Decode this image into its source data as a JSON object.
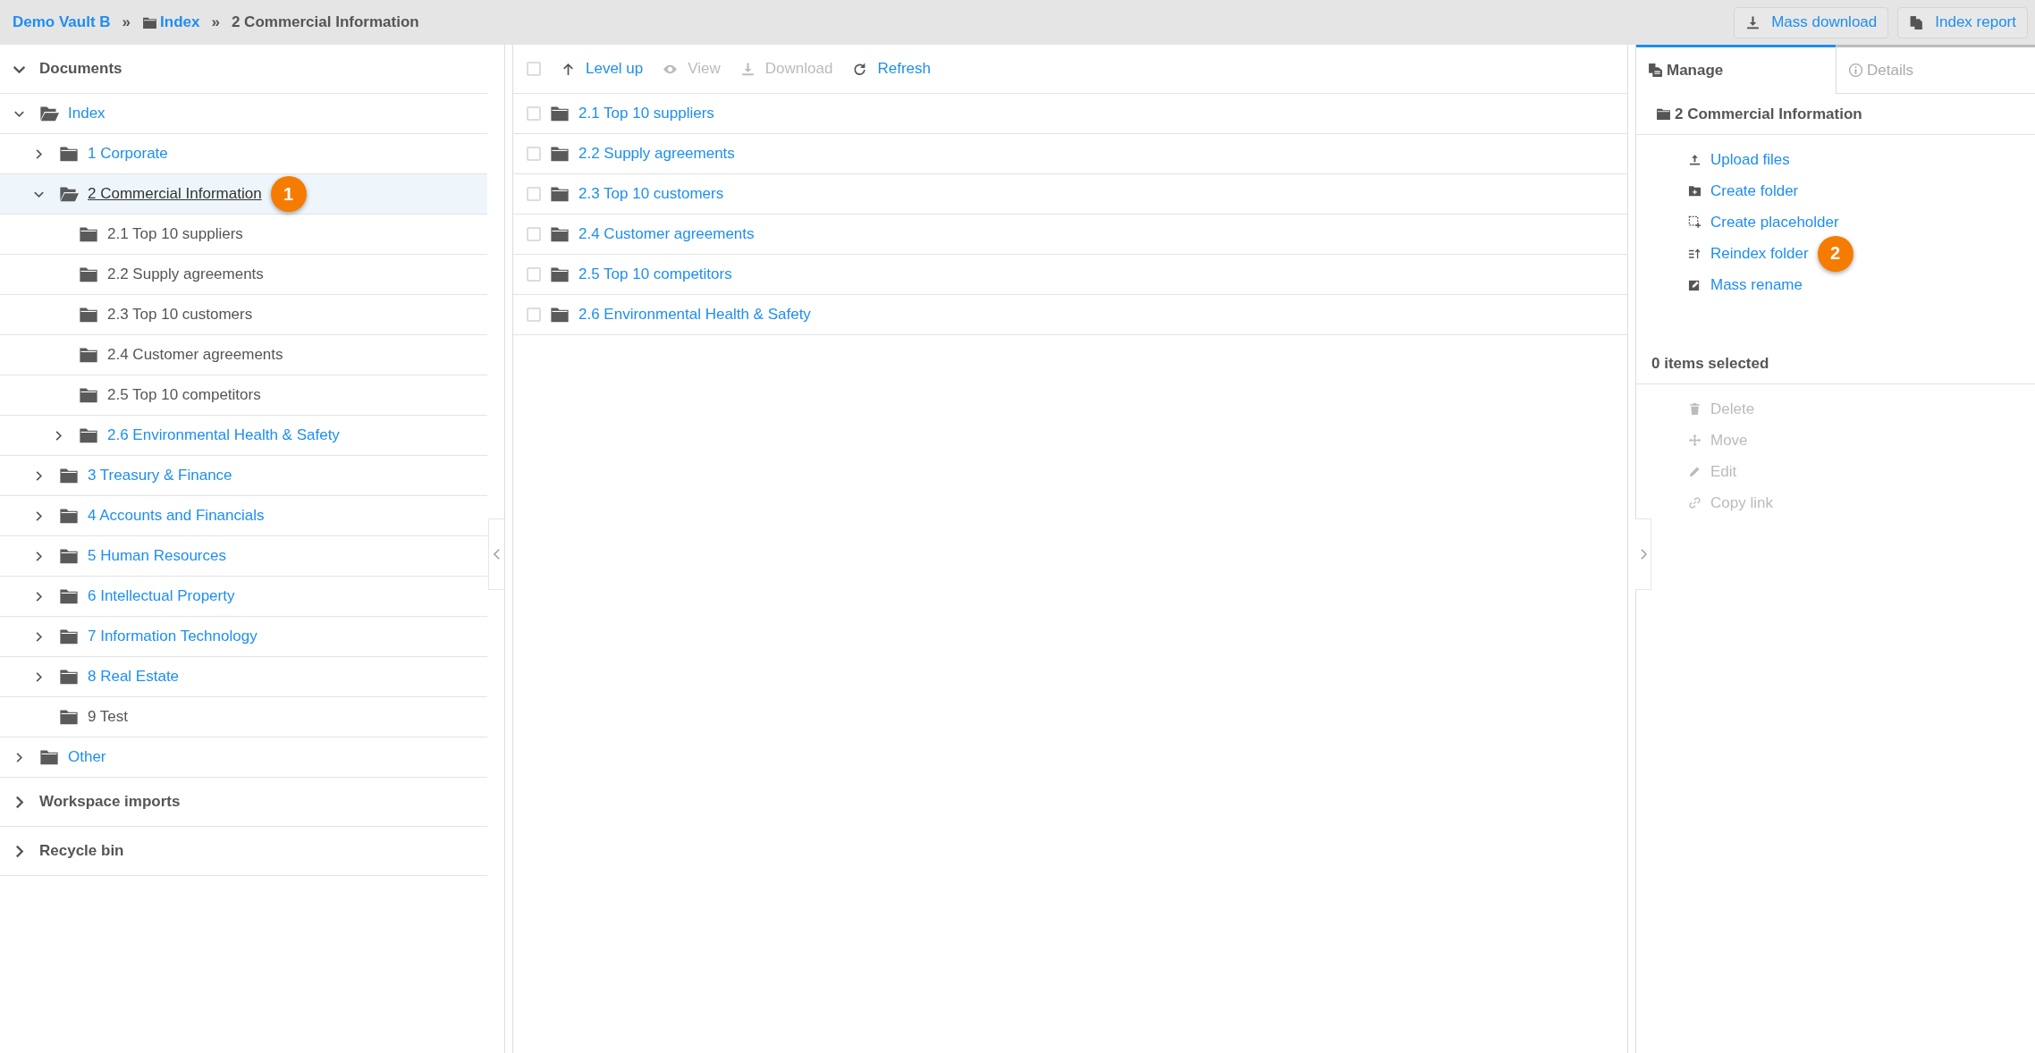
{
  "breadcrumb": [
    {
      "text": "Demo Vault B",
      "kind": "root"
    },
    {
      "text": "»",
      "kind": "separator"
    },
    {
      "text": "Index",
      "kind": "folder"
    },
    {
      "text": "»",
      "kind": "separator"
    },
    {
      "text": "2 Commercial Information",
      "kind": "current"
    }
  ],
  "top_actions": [
    {
      "label": "Mass download",
      "kind": "download"
    },
    {
      "label": "Index report",
      "kind": "report"
    }
  ],
  "sidebar": {
    "sections": [
      {
        "label": "Documents",
        "expanded": true,
        "children": [
          {
            "label": "Index",
            "expandable": true,
            "expanded": true,
            "selected": false,
            "children": [
              {
                "label": "1 Corporate",
                "expandable": true,
                "expanded": false,
                "selected": false
              },
              {
                "label": "2 Commercial Information",
                "expandable": true,
                "expanded": true,
                "selected": true,
                "badge": "1",
                "children": [
                  {
                    "label": "2.1 Top 10 suppliers",
                    "expandable": false,
                    "selected": false
                  },
                  {
                    "label": "2.2 Supply agreements",
                    "expandable": false,
                    "selected": false
                  },
                  {
                    "label": "2.3 Top 10 customers",
                    "expandable": false,
                    "selected": false
                  },
                  {
                    "label": "2.4 Customer agreements",
                    "expandable": false,
                    "selected": false
                  },
                  {
                    "label": "2.5 Top 10 competitors",
                    "expandable": false,
                    "selected": false
                  },
                  {
                    "label": "2.6 Environmental Health & Safety",
                    "expandable": true,
                    "expanded": false,
                    "selected": false
                  }
                ]
              },
              {
                "label": "3 Treasury & Finance",
                "expandable": true,
                "expanded": false,
                "selected": false
              },
              {
                "label": "4 Accounts and Financials",
                "expandable": true,
                "expanded": false,
                "selected": false
              },
              {
                "label": "5 Human Resources",
                "expandable": true,
                "expanded": false,
                "selected": false
              },
              {
                "label": "6 Intellectual Property",
                "expandable": true,
                "expanded": false,
                "selected": false
              },
              {
                "label": "7 Information Technology",
                "expandable": true,
                "expanded": false,
                "selected": false
              },
              {
                "label": "8 Real Estate",
                "expandable": true,
                "expanded": false,
                "selected": false
              },
              {
                "label": "9 Test",
                "expandable": false,
                "selected": false
              }
            ]
          },
          {
            "label": "Other",
            "expandable": true,
            "expanded": false,
            "selected": false
          }
        ]
      },
      {
        "label": "Workspace imports",
        "expanded": false
      },
      {
        "label": "Recycle bin",
        "expanded": false
      }
    ]
  },
  "toolbar": {
    "select_all": {
      "checked": false
    },
    "actions": [
      {
        "label": "Level up",
        "kind": "up",
        "disabled": false
      },
      {
        "label": "View",
        "kind": "view",
        "disabled": true
      },
      {
        "label": "Download",
        "kind": "download",
        "disabled": true
      },
      {
        "label": "Refresh",
        "kind": "refresh",
        "disabled": false
      }
    ]
  },
  "files": [
    {
      "name": "2.1 Top 10 suppliers",
      "checked": false
    },
    {
      "name": "2.2 Supply agreements",
      "checked": false
    },
    {
      "name": "2.3 Top 10 customers",
      "checked": false
    },
    {
      "name": "2.4 Customer agreements",
      "checked": false
    },
    {
      "name": "2.5 Top 10 competitors",
      "checked": false
    },
    {
      "name": "2.6 Environmental Health & Safety",
      "checked": false
    }
  ],
  "side_panel": {
    "tabs": [
      {
        "label": "Manage",
        "kind": "manage",
        "selected": true
      },
      {
        "label": "Details",
        "kind": "info",
        "selected": false
      }
    ],
    "folder_title": "2 Commercial Information",
    "actions": [
      {
        "label": "Upload files",
        "kind": "upload",
        "disabled": false
      },
      {
        "label": "Create folder",
        "kind": "folder-plus",
        "disabled": false
      },
      {
        "label": "Create placeholder",
        "kind": "placeholder",
        "disabled": false
      },
      {
        "label": "Reindex folder",
        "kind": "reindex",
        "disabled": false,
        "badge": "2"
      },
      {
        "label": "Mass rename",
        "kind": "rename",
        "disabled": false
      }
    ],
    "selection_count": "0 items selected",
    "selection_actions": [
      {
        "label": "Delete",
        "kind": "trash",
        "disabled": true
      },
      {
        "label": "Move",
        "kind": "move",
        "disabled": true
      },
      {
        "label": "Edit",
        "kind": "pencil",
        "disabled": true
      },
      {
        "label": "Copy link",
        "kind": "link",
        "disabled": true
      }
    ]
  }
}
